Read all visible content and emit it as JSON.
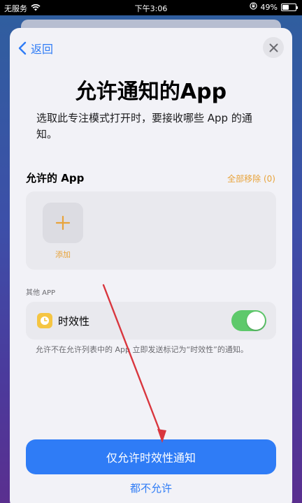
{
  "status_bar": {
    "carrier": "无服务",
    "time": "下午3:06",
    "battery": "49%",
    "battery_level": 0.49
  },
  "nav": {
    "back_label": "返回"
  },
  "header": {
    "title": "允许通知的App",
    "subtitle": "选取此专注模式打开时，要接收哪些 App 的通知。"
  },
  "allowed_apps": {
    "section_title": "允许的 App",
    "remove_all": "全部移除 (0)",
    "add_label": "添加"
  },
  "other_apps": {
    "section_label": "其他 APP",
    "time_sensitive_label": "时效性",
    "time_sensitive_on": true,
    "footnote": "允许不在允许列表中的 App 立即发送标记为“时效性”的通知。"
  },
  "actions": {
    "primary": "仅允许时效性通知",
    "secondary": "都不允许"
  },
  "colors": {
    "accent_blue": "#2f7cf6",
    "accent_orange": "#e8a33a",
    "toggle_green": "#5ec96b",
    "annotation_red": "#d9363e"
  }
}
